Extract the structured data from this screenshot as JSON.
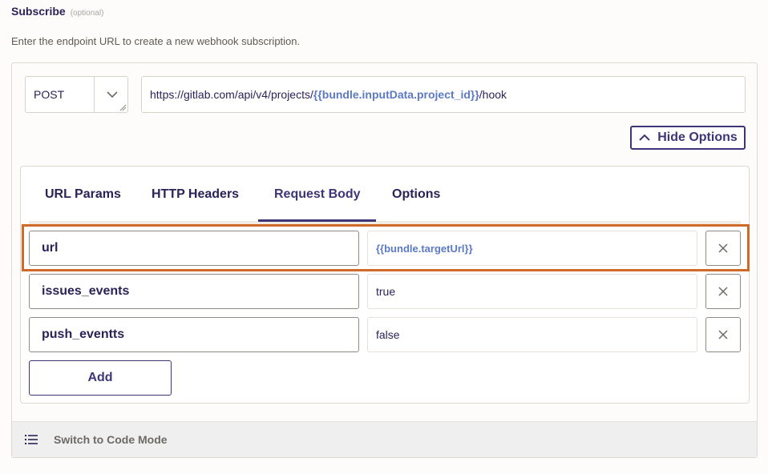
{
  "header": {
    "title": "Subscribe",
    "optional": "(optional)",
    "description": "Enter the endpoint URL to create a new webhook subscription."
  },
  "request": {
    "method": "POST",
    "url_prefix": "https://gitlab.com/api/v4/projects/",
    "url_token": "{{bundle.inputData.project_id}}",
    "url_suffix": "/hook"
  },
  "hide_options_label": "Hide Options",
  "tabs": [
    {
      "label": "URL Params",
      "active": false
    },
    {
      "label": "HTTP Headers",
      "active": false
    },
    {
      "label": "Request Body",
      "active": true
    },
    {
      "label": "Options",
      "active": false
    }
  ],
  "body_rows": [
    {
      "key": "url",
      "value": "{{bundle.targetUrl}}",
      "value_is_token": true,
      "highlighted": true
    },
    {
      "key": "issues_events",
      "value": "true",
      "value_is_token": false,
      "highlighted": false
    },
    {
      "key": "push_eventts",
      "value": "false",
      "value_is_token": false,
      "highlighted": false
    }
  ],
  "add_label": "Add",
  "footer": {
    "label": "Switch to Code Mode",
    "icon": "list-icon"
  },
  "colors": {
    "accent": "#3d3676",
    "token": "#5b79c4",
    "highlight": "#cf6a28"
  }
}
